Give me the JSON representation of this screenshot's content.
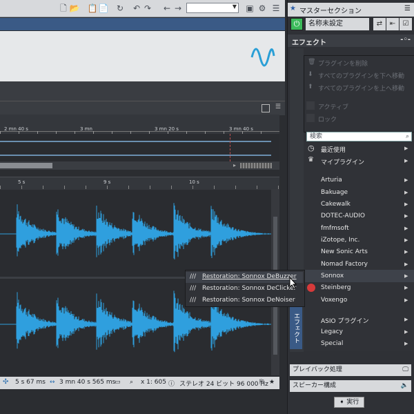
{
  "toolbar": {
    "icons": [
      "new-file-icon",
      "open-folder-icon",
      "paste-icon",
      "paste-new-icon",
      "history-icon",
      "undo-icon",
      "redo-icon",
      "back-arrow-icon",
      "forward-arrow-icon"
    ],
    "preset_value": ""
  },
  "overview_ruler": {
    "labels": [
      "2 mn 40 s",
      "3 mn",
      "3 mn 20 s",
      "3 mn 40 s"
    ]
  },
  "main_ruler": {
    "labels": [
      "5 s",
      "9 s",
      "10 s"
    ]
  },
  "status_bar": {
    "position": "5 s 67 ms",
    "length": "3 mn 40 s 565 ms",
    "zoom": "x 1: 605",
    "format": "ステレオ 24 ビット 96 000 Hz"
  },
  "master": {
    "title": "マスターセクション",
    "preset_name": "名称未設定",
    "effects_label": "エフェクト",
    "vertical_tab": "エフェクト"
  },
  "context_menu": {
    "items": [
      {
        "label": "プラグインを削除"
      },
      {
        "label": "すべてのプラグインを下へ移動"
      },
      {
        "label": "すべてのプラグインを上へ移動"
      },
      {
        "label": "アクティブ"
      },
      {
        "label": "ロック"
      }
    ]
  },
  "plugin_browser": {
    "search_placeholder": "検索",
    "recent": "最近使用",
    "my_plugins": "マイプラグイン",
    "vendors": [
      "Arturia",
      "Bakuage",
      "Cakewalk",
      "DOTEC-AUDIO",
      "fmfmsoft",
      "iZotope, Inc.",
      "New Sonic Arts",
      "Nomad Factory",
      "Sonnox",
      "Steinberg",
      "Voxengo"
    ],
    "groups": [
      "ASIO プラグイン",
      "Legacy",
      "Special"
    ]
  },
  "submenu": {
    "items": [
      {
        "label": "Restoration: Sonnox DeBuzzer"
      },
      {
        "label": "Restoration: Sonnox DeClicker"
      },
      {
        "label": "Restoration: Sonnox DeNoiser"
      }
    ]
  },
  "right_panels": {
    "playback": "プレイバック処理",
    "speaker": "スピーカー構成",
    "render": "実行"
  },
  "colors": {
    "waveform": "#2f9fde",
    "accent_blue": "#3a5a86",
    "power_green": "#3cba5b",
    "steinberg_red": "#d63a3a"
  }
}
